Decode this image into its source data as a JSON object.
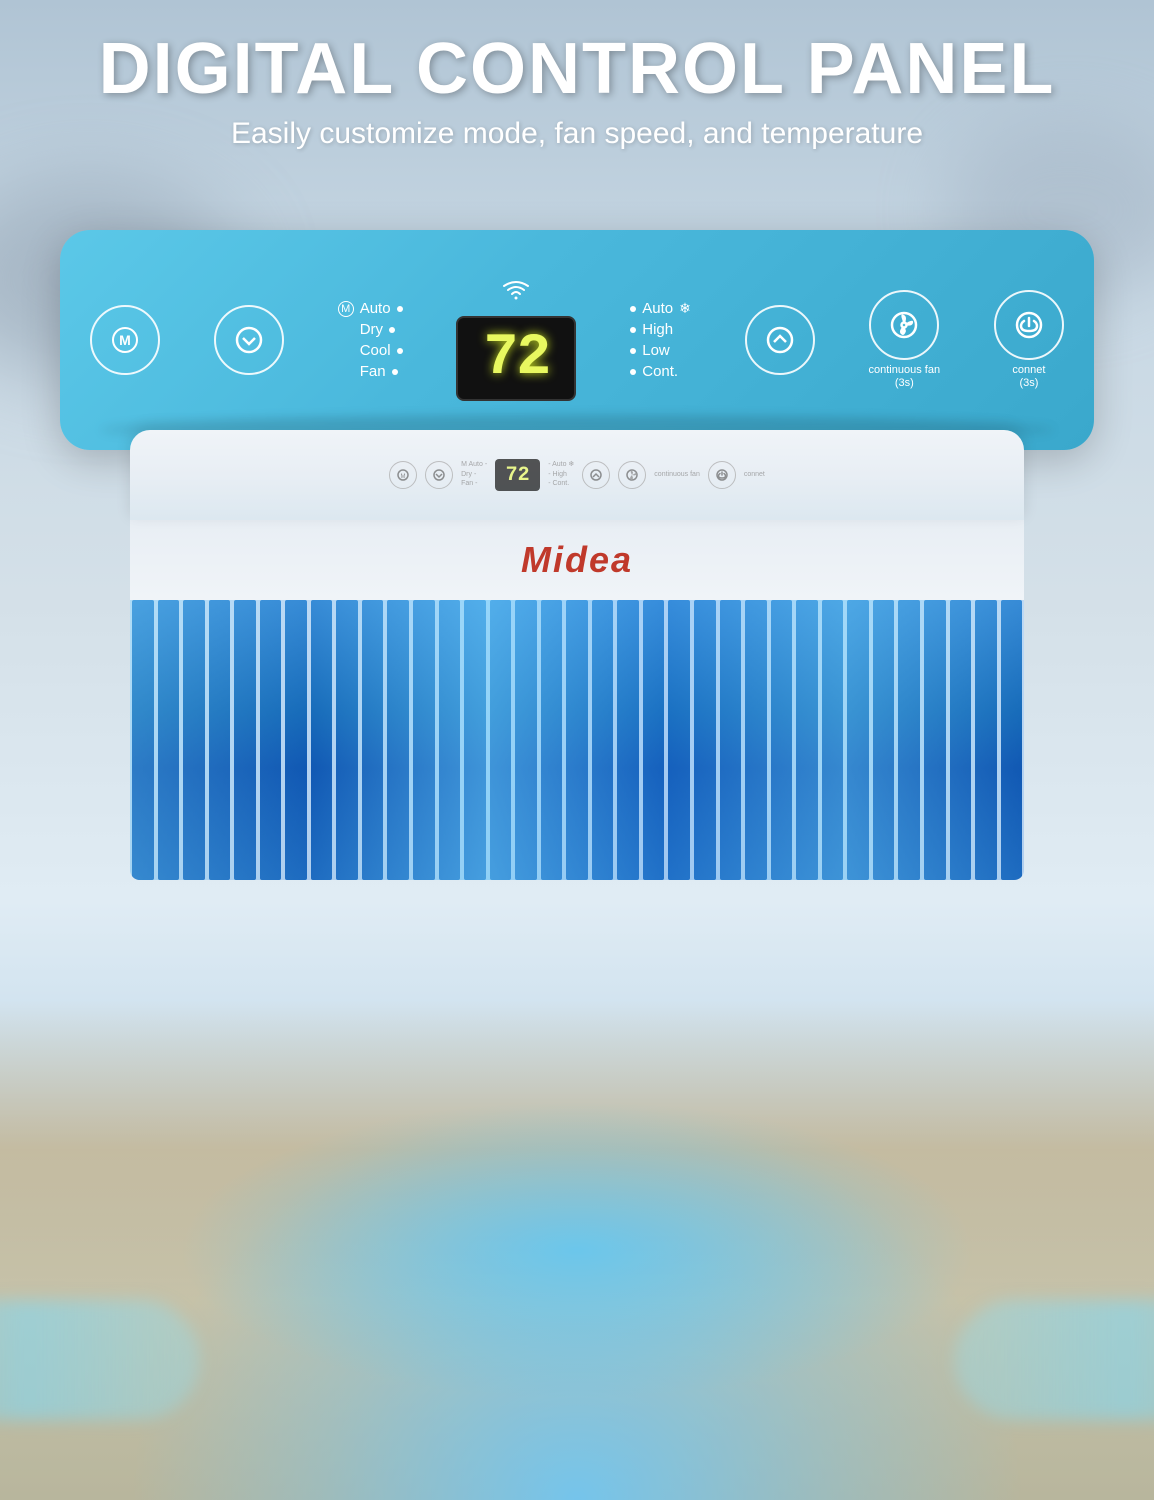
{
  "header": {
    "title": "DIGITAL CONTROL PANEL",
    "subtitle": "Easily customize mode, fan speed, and temperature"
  },
  "panel": {
    "wifi_icon": "📶",
    "temperature": "72",
    "mode_labels": [
      {
        "text": "Auto",
        "prefix": "M"
      },
      {
        "text": "Dry"
      },
      {
        "text": "Cool"
      },
      {
        "text": "Fan"
      }
    ],
    "speed_labels": [
      {
        "text": "Auto",
        "suffix": "❄"
      },
      {
        "text": "High"
      },
      {
        "text": "Low"
      },
      {
        "text": "Cont."
      }
    ],
    "buttons": [
      {
        "id": "mode",
        "label": "M",
        "icon": "mode"
      },
      {
        "id": "down",
        "label": "↓",
        "icon": "chevron-down"
      },
      {
        "id": "up",
        "label": "↑",
        "icon": "chevron-up"
      },
      {
        "id": "fan",
        "label": "fan",
        "icon": "fan"
      },
      {
        "id": "power",
        "label": "⏻",
        "icon": "power"
      }
    ],
    "continuous_fan_label": "continuous fan",
    "continuous_fan_sub": "(3s)",
    "connect_label": "connet",
    "connect_sub": "(3s)"
  },
  "product": {
    "brand": "Midea"
  },
  "colors": {
    "panel_bg": "#4bbcd8",
    "display_bg": "#111111",
    "display_text": "#e8f860",
    "grill_color": "#1860b0",
    "brand_color": "#cc2222"
  }
}
